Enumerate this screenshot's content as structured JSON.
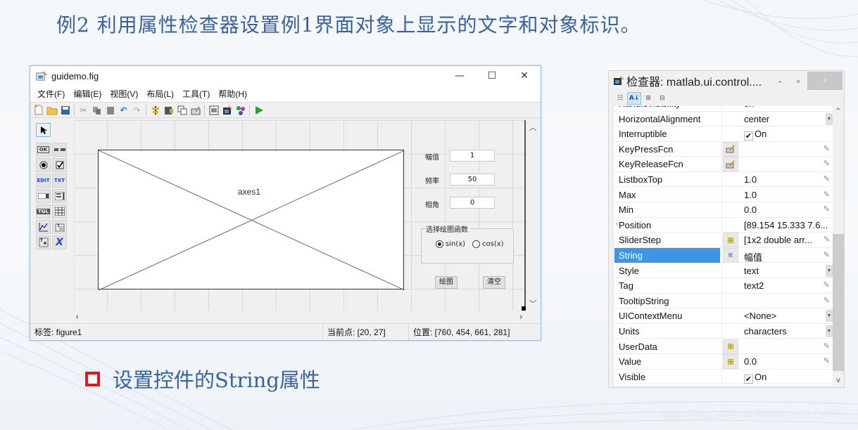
{
  "slide": {
    "title": "例2   利用属性检查器设置例1界面对象上显示的文字和对象标识。",
    "bullet": "设置控件的String属性",
    "watermark": "https://blog.csdn.net/weixin_44146373",
    "accent_color": "#e8161a",
    "text_color": "#3a62a0"
  },
  "guide": {
    "window_title": "guidemo.fig",
    "window_buttons": {
      "minimize": "—",
      "maximize": "☐",
      "close": "✕"
    },
    "menu": [
      "文件(F)",
      "编辑(E)",
      "视图(V)",
      "布局(L)",
      "工具(T)",
      "帮助(H)"
    ],
    "toolbar_icons": [
      "new-file-icon",
      "open-folder-icon",
      "save-icon",
      "cut-icon",
      "copy-icon",
      "paste-icon",
      "undo-icon",
      "redo-icon",
      "align-icon",
      "menu-editor-icon",
      "tab-order-icon",
      "toolbar-editor-icon",
      "editor-icon",
      "property-inspector-icon",
      "object-browser-icon",
      "run-icon"
    ],
    "palette": [
      {
        "icon": "select-arrow-icon",
        "label": ""
      },
      {
        "icon": "push-button-icon",
        "label": "OK"
      },
      {
        "icon": "slider-icon",
        "label": ""
      },
      {
        "icon": "radio-button-icon",
        "label": ""
      },
      {
        "icon": "checkbox-icon",
        "label": ""
      },
      {
        "icon": "edit-text-icon",
        "label": "EDIT"
      },
      {
        "icon": "static-text-icon",
        "label": "TXT"
      },
      {
        "icon": "popup-menu-icon",
        "label": ""
      },
      {
        "icon": "listbox-icon",
        "label": ""
      },
      {
        "icon": "toggle-button-icon",
        "label": "TGL"
      },
      {
        "icon": "table-icon",
        "label": ""
      },
      {
        "icon": "axes-icon",
        "label": ""
      },
      {
        "icon": "panel-icon",
        "label": "T"
      },
      {
        "icon": "button-group-icon",
        "label": "T"
      },
      {
        "icon": "activex-icon",
        "label": "X"
      }
    ],
    "axes_label": "axes1",
    "controls": {
      "amplitude_label": "幅值",
      "amplitude_value": "1",
      "frequency_label": "频率",
      "frequency_value": "50",
      "phase_label": "相角",
      "phase_value": "0",
      "panel_title": "选择绘图函数",
      "radio_sin": "sin(x)",
      "radio_cos": "cos(x)",
      "radio_selected": "sin(x)",
      "plot_button": "绘图",
      "clear_button": "清空"
    },
    "status": {
      "tag": "标签: figure1",
      "current_point": "当前点:  [20, 27]",
      "position": "位置: [760, 454, 661, 281]"
    }
  },
  "inspector": {
    "title": "检查器:  matlab.ui.control....",
    "buttons": {
      "minimize": "-",
      "maximize": "▫",
      "close": "×"
    },
    "toolbar": [
      "categorized-icon",
      "sort-alpha-icon",
      "expand-all-icon",
      "collapse-all-icon"
    ],
    "partial_row": {
      "name": "HandleVisibility",
      "value": "on"
    },
    "rows": [
      {
        "name": "HorizontalAlignment",
        "value": "center",
        "editor": "dropdown"
      },
      {
        "name": "Interruptible",
        "value": "On",
        "editor": "checkbox",
        "checked": true
      },
      {
        "name": "KeyPressFcn",
        "value": "",
        "editor": "pencil",
        "button": "callback"
      },
      {
        "name": "KeyReleaseFcn",
        "value": "",
        "editor": "pencil",
        "button": "callback"
      },
      {
        "name": "ListboxTop",
        "value": "1.0",
        "editor": "pencil"
      },
      {
        "name": "Max",
        "value": "1.0",
        "editor": "pencil"
      },
      {
        "name": "Min",
        "value": "0.0",
        "editor": "pencil"
      },
      {
        "name": "Position",
        "value": "[89.154 15.333 7.6...",
        "editor": "none",
        "expandable": true
      },
      {
        "name": "SliderStep",
        "value": "[1x2  double arr...",
        "editor": "pencil",
        "button": "array"
      },
      {
        "name": "String",
        "value": "幅值",
        "editor": "pencil",
        "button": "text",
        "selected": true
      },
      {
        "name": "Style",
        "value": "text",
        "editor": "dropdown"
      },
      {
        "name": "Tag",
        "value": "text2",
        "editor": "pencil"
      },
      {
        "name": "TooltipString",
        "value": "",
        "editor": "pencil"
      },
      {
        "name": "UIContextMenu",
        "value": "<None>",
        "editor": "dropdown"
      },
      {
        "name": "Units",
        "value": "characters",
        "editor": "dropdown"
      },
      {
        "name": "UserData",
        "value": "",
        "editor": "pencil",
        "button": "array"
      },
      {
        "name": "Value",
        "value": "0.0",
        "editor": "pencil",
        "button": "array"
      },
      {
        "name": "Visible",
        "value": "On",
        "editor": "checkbox",
        "checked": true
      }
    ]
  }
}
